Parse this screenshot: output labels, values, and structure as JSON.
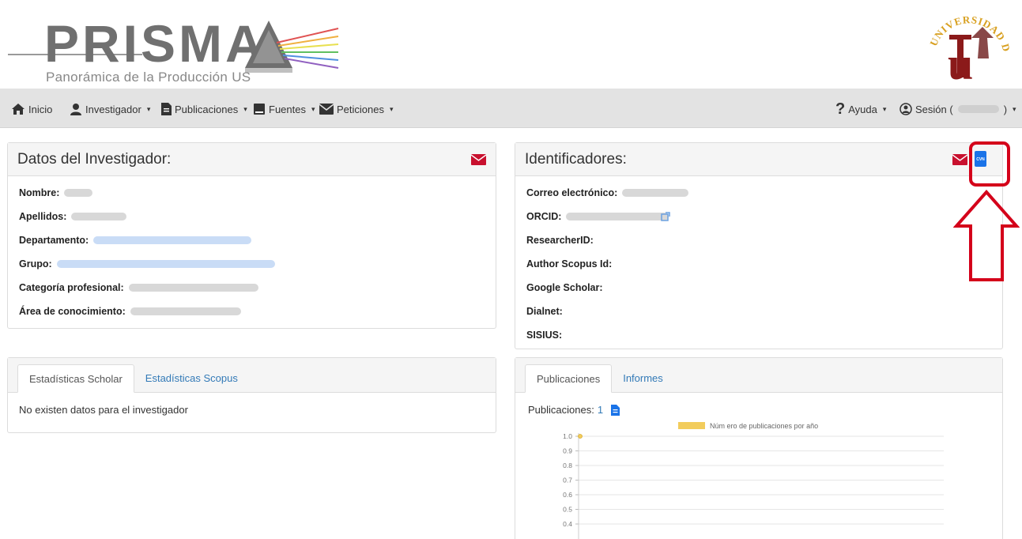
{
  "header": {
    "logo_text": "PRISMA",
    "logo_subtitle": "Panorámica de la Producción US",
    "seal_text": "UNIVERSIDAD DE SEVILLA"
  },
  "nav": {
    "items": [
      {
        "label": "Inicio",
        "icon": "home-icon"
      },
      {
        "label": "Investigador",
        "icon": "user-icon"
      },
      {
        "label": "Publicaciones",
        "icon": "document-icon"
      },
      {
        "label": "Fuentes",
        "icon": "book-icon"
      },
      {
        "label": "Peticiones",
        "icon": "envelope-icon"
      }
    ],
    "right": [
      {
        "label": "Ayuda",
        "icon": "question-icon"
      },
      {
        "label": "Sesión (",
        "suffix": ")",
        "icon": "user-circle-icon"
      }
    ],
    "caret": "▾"
  },
  "investigator": {
    "title": "Datos del Investigador:",
    "fields": [
      {
        "label": "Nombre:"
      },
      {
        "label": "Apellidos:"
      },
      {
        "label": "Departamento:"
      },
      {
        "label": "Grupo:"
      },
      {
        "label": "Categoría profesional:"
      },
      {
        "label": "Área de conocimiento:"
      }
    ]
  },
  "identifiers": {
    "title": "Identificadores:",
    "cvn_label": "CVN",
    "fields": [
      {
        "label": "Correo electrónico:"
      },
      {
        "label": "ORCID:"
      },
      {
        "label": "ResearcherID:"
      },
      {
        "label": "Author Scopus Id:"
      },
      {
        "label": "Google Scholar:"
      },
      {
        "label": "Dialnet:"
      },
      {
        "label": "SISIUS:"
      }
    ]
  },
  "stats": {
    "tabs": [
      "Estadísticas Scholar",
      "Estadísticas Scopus"
    ],
    "message": "No existen datos para el investigador"
  },
  "publications": {
    "tabs": [
      "Publicaciones",
      "Informes"
    ],
    "count_label": "Publicaciones:",
    "count": "1"
  },
  "colors": {
    "accent_red": "#c8102e",
    "link_blue": "#337ab7",
    "cvn_blue": "#1a73e8",
    "chart_yellow": "#f2cc5c"
  },
  "chart_data": {
    "type": "line",
    "legend": "Núm ero de publicaciones por año",
    "legend_placement": "top",
    "y_ticks": [
      "1.0",
      "0.9",
      "0.8",
      "0.7",
      "0.6",
      "0.5",
      "0.4"
    ],
    "ylim": [
      0.4,
      1.0
    ],
    "grid": true,
    "series": [
      {
        "name": "Núm ero de publicaciones por año",
        "values": [
          1.0
        ]
      }
    ]
  }
}
